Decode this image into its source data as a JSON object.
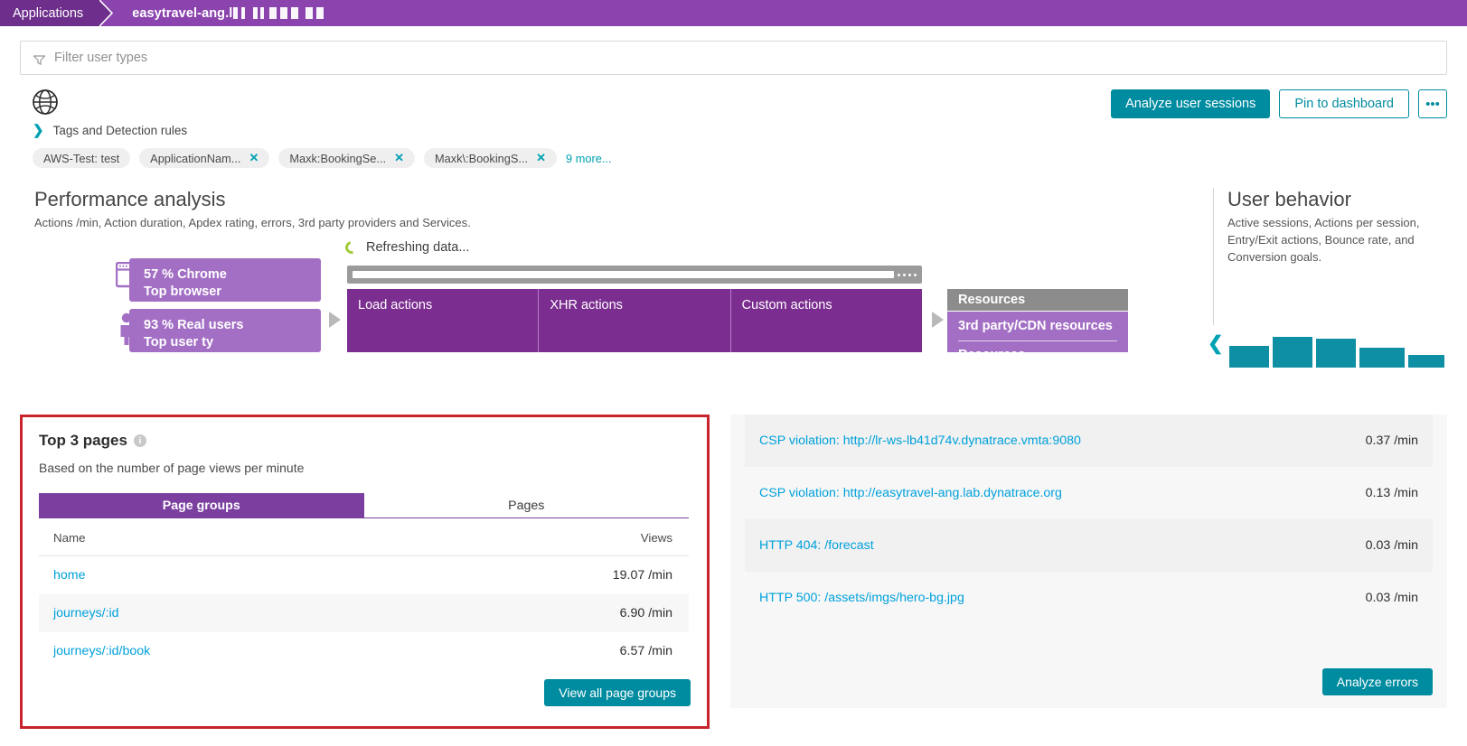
{
  "topbar": {
    "app_crumb": "Applications",
    "title_visible": "easytravel-ang.l",
    "title_redacted_note": "redacted"
  },
  "filter": {
    "icon": "funnel-icon",
    "placeholder": "Filter user types",
    "value": ""
  },
  "detail_header": {
    "entity_icon": "globe-icon",
    "actions": {
      "analyze_sessions": "Analyze user sessions",
      "pin_to_dashboard": "Pin to dashboard",
      "more": "•••"
    },
    "tags_toggle": {
      "icon": "chevron-right-icon",
      "label": "Tags and Detection rules"
    },
    "tags": [
      {
        "label": "AWS-Test: test",
        "removable": false
      },
      {
        "label": "ApplicationNam...",
        "removable": true
      },
      {
        "label": "Maxk:BookingSe...",
        "removable": true
      },
      {
        "label": "Maxk\\:BookingS...",
        "removable": true
      }
    ],
    "tags_more": "9 more..."
  },
  "performance": {
    "title": "Performance analysis",
    "subtitle": "Actions /min, Action duration, Apdex rating, errors, 3rd party providers and Services.",
    "refresh_status": "Refreshing data...",
    "browser_tile": {
      "stat": "57 % Chrome",
      "label": "Top browser",
      "icon": "browser-window-icon"
    },
    "users_tile": {
      "stat": "93 % Real users",
      "label": "Top user ty",
      "icon": "person-icon"
    },
    "action_columns": [
      "Load actions",
      "XHR actions",
      "Custom actions"
    ],
    "resources": {
      "header": "Resources",
      "line1": "3rd party/CDN resources",
      "line2": "Resources"
    }
  },
  "user_behavior": {
    "title": "User behavior",
    "subtitle": "Active sessions, Actions per session, Entry/Exit actions, Bounce rate, and Conversion goals."
  },
  "top_pages": {
    "title": "Top 3 pages",
    "info_icon": "info-icon",
    "subtitle": "Based on the number of page views per minute",
    "tabs": [
      {
        "label": "Page groups",
        "active": true
      },
      {
        "label": "Pages",
        "active": false
      }
    ],
    "columns": [
      "Name",
      "Views"
    ],
    "rows": [
      {
        "name": "home",
        "views": "19.07 /min"
      },
      {
        "name": "journeys/:id",
        "views": "6.90 /min"
      },
      {
        "name": "journeys/:id/book",
        "views": "6.57 /min"
      }
    ],
    "footer_button": "View all page groups"
  },
  "errors_panel": {
    "rows": [
      {
        "name": "CSP violation: http://lr-ws-lb41d74v.dynatrace.vmta:9080",
        "rate": "0.37 /min"
      },
      {
        "name": "CSP violation: http://easytravel-ang.lab.dynatrace.org",
        "rate": "0.13 /min"
      },
      {
        "name": "HTTP 404: /forecast",
        "rate": "0.03 /min"
      },
      {
        "name": "HTTP 500: /assets/imgs/hero-bg.jpg",
        "rate": "0.03 /min"
      }
    ],
    "footer_button": "Analyze errors"
  },
  "colors": {
    "breadcrumb_purple": "#8B44AD",
    "breadcrumb_dark": "#6E2F8C",
    "tile_purple": "#A36FC4",
    "actions_purple": "#7B2D90",
    "tab_purple": "#7B3FA0",
    "teal": "#008CA0",
    "link_blue": "#00A1DB",
    "highlight_red": "#C7242C",
    "spinner_green": "#A3CC3A",
    "bar_teal": "#0E8FA3"
  }
}
